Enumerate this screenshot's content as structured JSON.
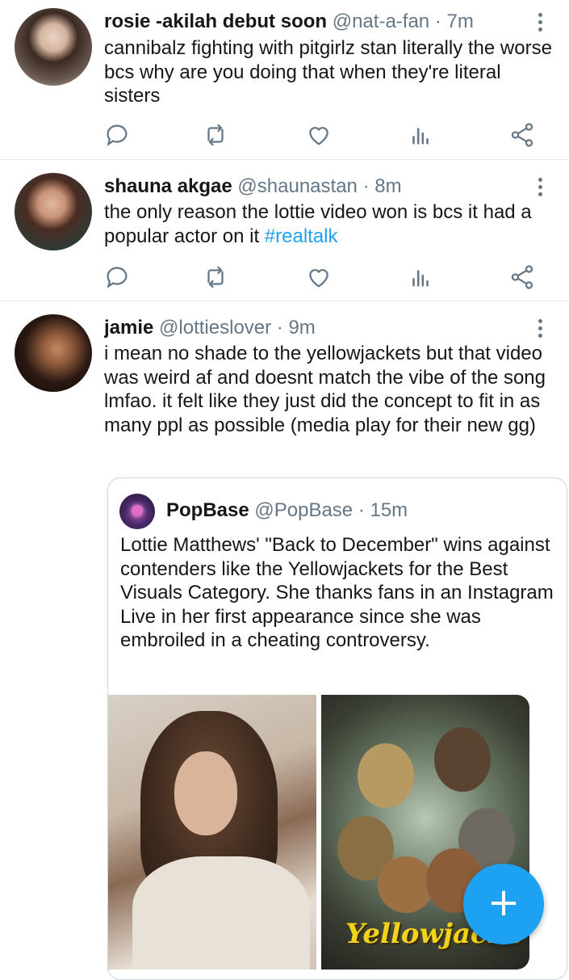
{
  "tweets": [
    {
      "name": "rosie -akilah debut soon",
      "handle": "@nat-a-fan",
      "time": "· 7m",
      "text": "cannibalz fighting with pitgirlz stan literally the worse bcs why are you doing that when they're literal sisters"
    },
    {
      "name": "shauna akgae",
      "handle": "@shaunastan",
      "time": "· 8m",
      "text": "the only reason the lottie video won is bcs it had a popular actor on it ",
      "hashtag": "#realtalk"
    },
    {
      "name": "jamie",
      "handle": "@lottieslover",
      "time": "· 9m",
      "text": "i mean no shade to the yellowjackets but that video was weird af and doesnt match the vibe of the song lmfao. it felt like they just did the concept to fit in as many ppl as possible (media play for their new gg)"
    }
  ],
  "quote": {
    "name": "PopBase",
    "handle": "@PopBase",
    "time": "· 15m",
    "text": "Lottie Matthews' \"Back to December\" wins against contenders like the Yellowjackets for the Best Visuals Category. She thanks fans in an Instagram Live in her first appearance since she was embroiled in a cheating controversy.",
    "image2_title": "Yellowjacke"
  },
  "icons": {
    "reply": "reply-icon",
    "retweet": "retweet-icon",
    "like": "heart-icon",
    "analytics": "analytics-icon",
    "share": "share-icon",
    "more": "more-vertical-icon",
    "compose": "plus-icon"
  },
  "fab": {
    "label": "+"
  },
  "colors": {
    "accent": "#1da1f2",
    "icon_gray": "#657786",
    "divider": "#e1e8ed"
  }
}
